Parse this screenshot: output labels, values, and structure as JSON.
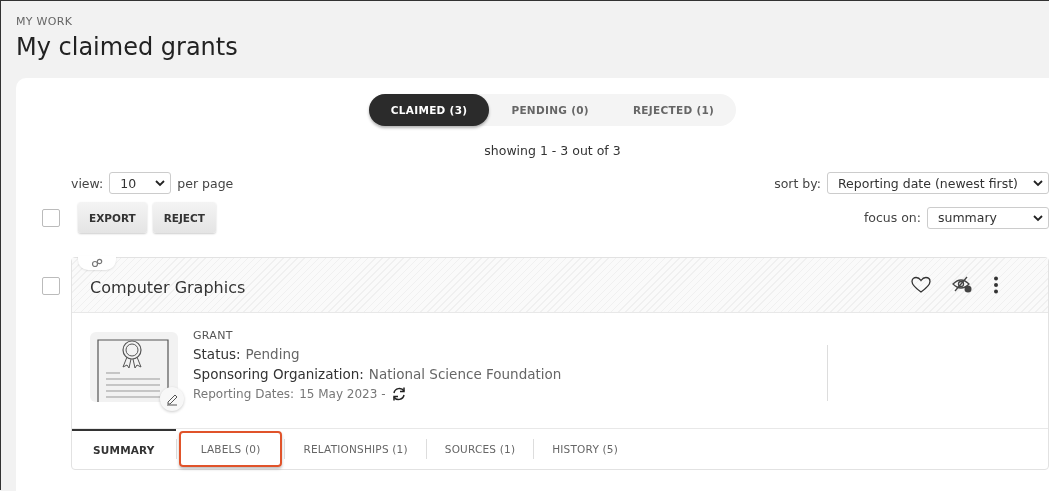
{
  "breadcrumb": "MY WORK",
  "title": "My claimed grants",
  "status_tabs": [
    {
      "label": "CLAIMED (3)",
      "selected": true
    },
    {
      "label": "PENDING (0)",
      "selected": false
    },
    {
      "label": "REJECTED (1)",
      "selected": false
    }
  ],
  "showing": "showing 1 - 3 out of 3",
  "view": {
    "label": "view:",
    "value": "10",
    "suffix": "per page"
  },
  "sort": {
    "label": "sort by:",
    "value": "Reporting date (newest first)"
  },
  "focus": {
    "label": "focus on:",
    "value": "summary"
  },
  "select_all": {
    "checked": false
  },
  "buttons": [
    "EXPORT",
    "REJECT"
  ],
  "card": {
    "checked": false,
    "title": "Computer Graphics",
    "type": "GRANT",
    "fields": [
      {
        "label": "Status:",
        "value": "Pending"
      },
      {
        "label": "Sponsoring Organization:",
        "value": "National Science Foundation"
      }
    ],
    "dates": {
      "label": "Reporting Dates:",
      "value": "15 May 2023 -"
    },
    "tabs": [
      {
        "label": "SUMMARY",
        "selected": true,
        "highlighted": false
      },
      {
        "label": "LABELS (0)",
        "selected": false,
        "highlighted": true
      },
      {
        "label": "RELATIONSHIPS (1)",
        "selected": false,
        "highlighted": false
      },
      {
        "label": "SOURCES (1)",
        "selected": false,
        "highlighted": false
      },
      {
        "label": "HISTORY (5)",
        "selected": false,
        "highlighted": false
      }
    ]
  }
}
